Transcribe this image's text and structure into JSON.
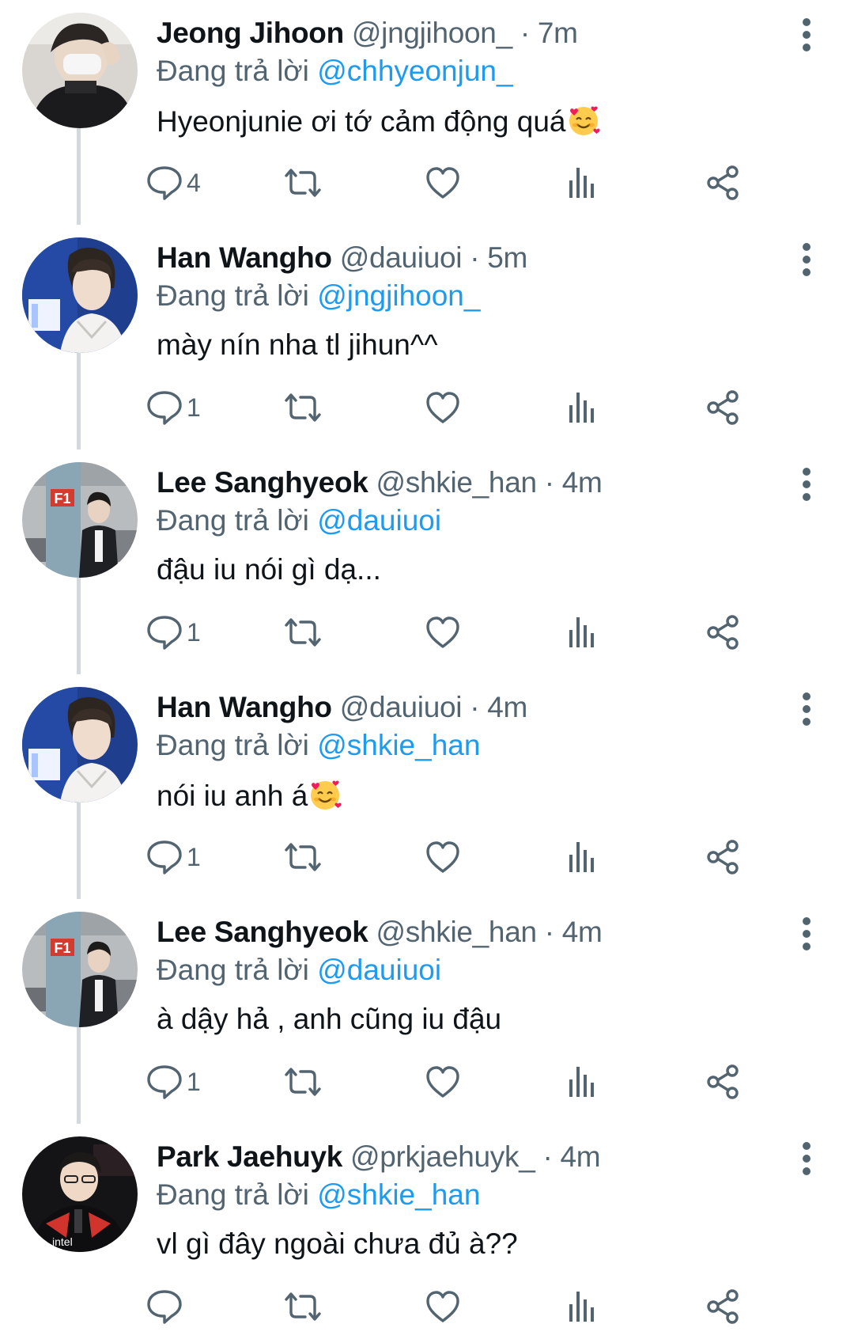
{
  "thread": {
    "tweets": [
      {
        "display_name": "Jeong Jihoon",
        "handle": "@jngjihoon_",
        "separator": "·",
        "time": "7m",
        "replying_prefix": "Đang trả lời",
        "replying_to": "@chhyeonjun_",
        "text": "Hyeonjunie ơi tớ cảm động quá",
        "emoji": "smiling-face-with-hearts",
        "reply_count": "4",
        "avatar": "photo-person-masked"
      },
      {
        "display_name": "Han Wangho",
        "handle": "@dauiuoi",
        "separator": "·",
        "time": "5m",
        "replying_prefix": "Đang trả lời",
        "replying_to": "@jngjihoon_",
        "text": "mày nín nha tl jihun^^",
        "emoji": "",
        "reply_count": "1",
        "avatar": "photo-person-blue-light"
      },
      {
        "display_name": "Lee Sanghyeok",
        "handle": "@shkie_han",
        "separator": "·",
        "time": "4m",
        "replying_prefix": "Đang trả lời",
        "replying_to": "@dauiuoi",
        "text": "đậu iu nói gì dạ...",
        "emoji": "",
        "reply_count": "1",
        "avatar": "photo-person-parking-garage-f1"
      },
      {
        "display_name": "Han Wangho",
        "handle": "@dauiuoi",
        "separator": "·",
        "time": "4m",
        "replying_prefix": "Đang trả lời",
        "replying_to": "@shkie_han",
        "text": "nói iu anh á",
        "emoji": "smiling-face-with-hearts",
        "reply_count": "1",
        "avatar": "photo-person-blue-light"
      },
      {
        "display_name": "Lee Sanghyeok",
        "handle": "@shkie_han",
        "separator": "·",
        "time": "4m",
        "replying_prefix": "Đang trả lời",
        "replying_to": "@dauiuoi",
        "text": "à dậy hả , anh cũng iu đậu",
        "emoji": "",
        "reply_count": "1",
        "avatar": "photo-person-parking-garage-f1"
      },
      {
        "display_name": "Park Jaehuyk",
        "handle": "@prkjaehuyk_",
        "separator": "·",
        "time": "4m",
        "replying_prefix": "Đang trả lời",
        "replying_to": "@shkie_han",
        "text": "vl gì đây ngoài chưa đủ à??",
        "emoji": "",
        "reply_count": "",
        "avatar": "photo-person-microphone-dark"
      }
    ]
  },
  "colors": {
    "text_primary": "#0f1419",
    "text_secondary": "#536471",
    "link": "#1d9bf0",
    "thread_line": "#cfd9de"
  },
  "icons": {
    "more": "more-vertical-icon",
    "reply": "reply-icon",
    "retweet": "retweet-icon",
    "like": "heart-icon",
    "views": "views-icon",
    "share": "share-icon"
  }
}
